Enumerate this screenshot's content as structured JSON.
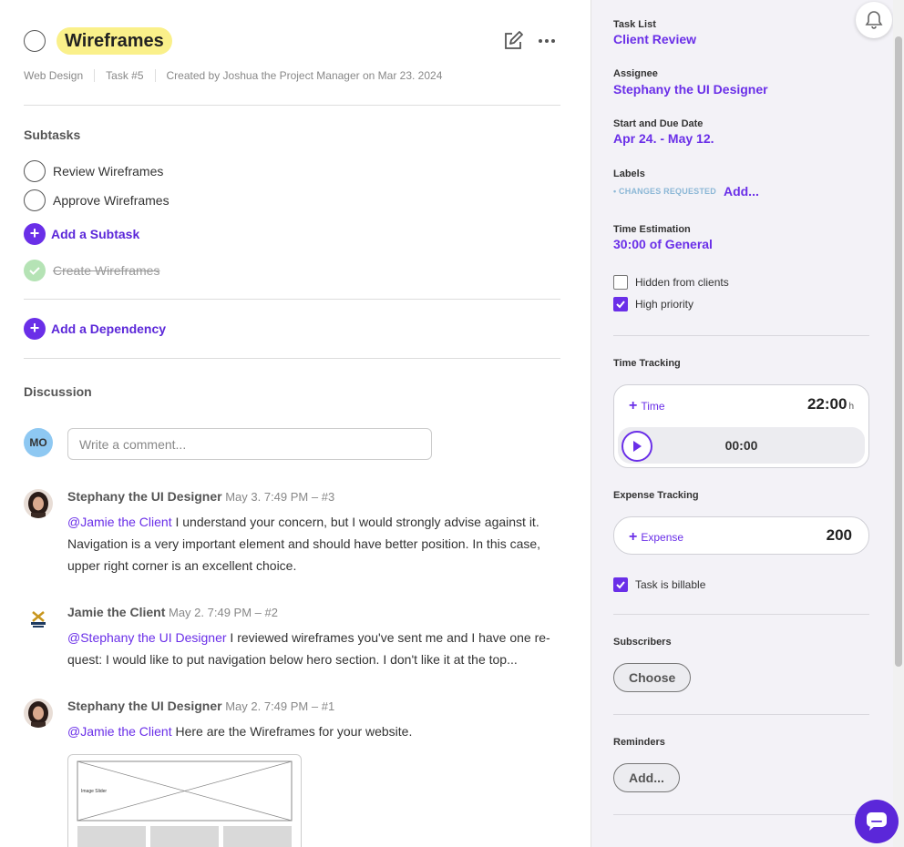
{
  "task": {
    "title": "Wireframes",
    "project": "Web Design",
    "number": "Task #5",
    "created": "Created by Joshua the Project Manager on Mar 23. 2024"
  },
  "subtasks": {
    "heading": "Subtasks",
    "items": [
      "Review Wireframes",
      "Approve Wireframes"
    ],
    "add_label": "Add a Subtask",
    "completed": [
      "Create Wireframes"
    ]
  },
  "dependency": {
    "add_label": "Add a Dependency"
  },
  "discussion": {
    "heading": "Discussion",
    "me_initials": "MO",
    "comment_placeholder": "Write a comment...",
    "comments": [
      {
        "author": "Stephany the UI Designer",
        "when": "May 3. 7:49 PM – #3",
        "mention": "@Jamie the Client",
        "text": " I understand your concern, but I would strongly advise against it. Navigation is a very important element and should have better position. In this case, upper right corner is an excellent choice."
      },
      {
        "author": "Jamie the Client",
        "when": "May 2. 7:49 PM – #2",
        "mention": "@Stephany the UI Designer",
        "text": " I reviewed wireframes you've sent me and I have one re-quest: I would like to put navigation below hero section. I don't like it at the top..."
      },
      {
        "author": "Stephany the UI Designer",
        "when": "May 2. 7:49 PM – #1",
        "mention": "@Jamie the Client",
        "text": " Here are the Wireframes for your website."
      }
    ],
    "attachment_caption": "Image Slider"
  },
  "sidebar": {
    "task_list_label": "Task List",
    "task_list_value": "Client Review",
    "assignee_label": "Assignee",
    "assignee_value": "Stephany the UI Designer",
    "dates_label": "Start and Due Date",
    "dates_value": "Apr 24. - May 12.",
    "labels_label": "Labels",
    "label_chip": "• CHANGES REQUESTED",
    "label_add": "Add...",
    "estimation_label": "Time Estimation",
    "estimation_value": "30:00 of General",
    "hidden_label": "Hidden from clients",
    "hidden_checked": false,
    "priority_label": "High priority",
    "priority_checked": true,
    "time_tracking_label": "Time Tracking",
    "add_time": "Time",
    "time_total": "22:00",
    "time_unit": "h",
    "timer": "00:00",
    "expense_label": "Expense Tracking",
    "add_expense": "Expense",
    "expense_amount": "200",
    "billable_label": "Task is billable",
    "billable_checked": true,
    "subscribers_label": "Subscribers",
    "subscribers_button": "Choose",
    "reminders_label": "Reminders",
    "reminders_button": "Add..."
  },
  "colors": {
    "accent": "#6a2fe8",
    "highlight": "#faf08a",
    "sidebar_bg": "#f3f2f7"
  }
}
